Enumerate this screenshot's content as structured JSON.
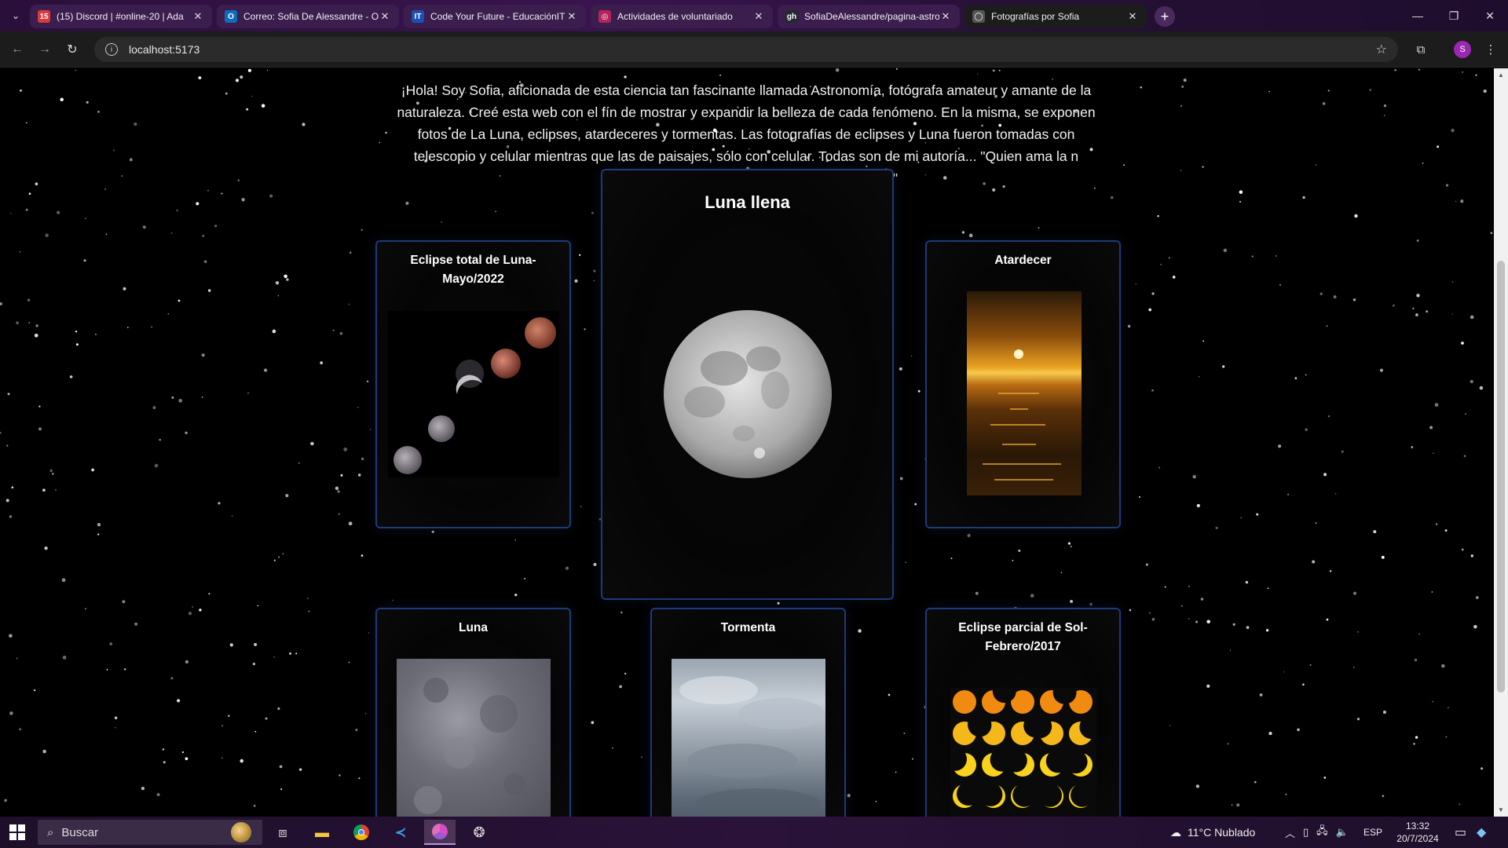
{
  "browser": {
    "tabs": [
      {
        "title": "(15) Discord | #online-20 | Ada",
        "favicon_badge": "15",
        "favicon_color": "#5865F2"
      },
      {
        "title": "Correo: Sofia De Alessandre - O",
        "favicon_badge": "O",
        "favicon_color": "#0f6cbd"
      },
      {
        "title": "Code Your Future - EducaciónIT",
        "favicon_badge": "IT",
        "favicon_color": "#1a4fb3"
      },
      {
        "title": "Actividades de voluntariado",
        "favicon_badge": "◎",
        "favicon_color": "#b4235a"
      },
      {
        "title": "SofiaDeAlessandre/pagina-astro",
        "favicon_badge": "gh",
        "favicon_color": "#24292f"
      },
      {
        "title": "Fotografías por Sofia",
        "favicon_badge": "◯",
        "favicon_color": "#555555"
      }
    ],
    "active_tab_index": 5,
    "address": "localhost:5173",
    "profile_initial": "S",
    "profile_color": "#9c27b0"
  },
  "page": {
    "intro_text": "¡Hola! Soy Sofia, aficionada de esta ciencia tan fascinante llamada Astronomía, fotógrafa amateur y amante de la naturaleza. Creé esta web con el fín de mostrar y expandir la belleza de cada fenómeno. En la misma, se exponen fotos de La Luna, eclipses, atardeceres y tormentas. Las fotografías de eclipses y Luna fueron tomadas con telescopio y celular mientras que las de paisajes, sólo con celular. Todas son de mi autoría... \"Quien ama la n",
    "intro_tail": "\"",
    "cards": {
      "eclipse_luna": {
        "title": "Eclipse total de Luna-Mayo/2022"
      },
      "luna_llena": {
        "title": "Luna llena"
      },
      "atardecer": {
        "title": "Atardecer"
      },
      "luna": {
        "title": "Luna"
      },
      "tormenta": {
        "title": "Tormenta"
      },
      "eclipse_sol": {
        "title": "Eclipse parcial de Sol-Febrero/2017"
      }
    },
    "card_border_color": "#1e3a78"
  },
  "taskbar": {
    "search_placeholder": "Buscar",
    "weather": "11°C  Nublado",
    "language": "ESP",
    "time": "13:32",
    "date": "20/7/2024"
  }
}
